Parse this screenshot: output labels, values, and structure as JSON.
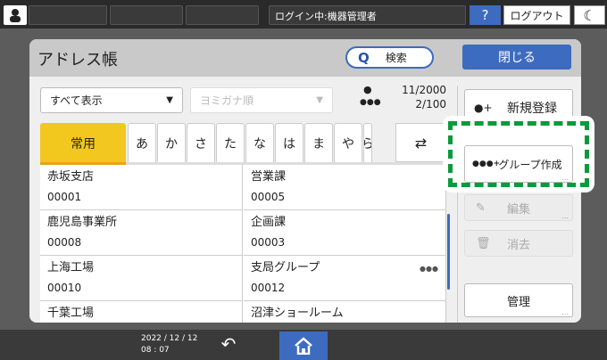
{
  "topbar": {
    "login_status": "ログイン中:機器管理者",
    "help_label": "?",
    "logout_label": "ログアウト"
  },
  "header": {
    "title": "アドレス帳",
    "search_label": "検索",
    "close_label": "閉じる"
  },
  "filters": {
    "display_select": "すべて表示",
    "sort_select": "ヨミガナ順"
  },
  "counts": {
    "users": "11/2000",
    "groups": "2/100"
  },
  "tabs": [
    "常用",
    "あ",
    "か",
    "さ",
    "た",
    "な",
    "は",
    "ま",
    "や",
    "ら"
  ],
  "entries": [
    {
      "name": "赤坂支店",
      "id": "00001",
      "group": false
    },
    {
      "name": "営業課",
      "id": "00005",
      "group": false
    },
    {
      "name": "鹿児島事業所",
      "id": "00008",
      "group": false
    },
    {
      "name": "企画課",
      "id": "00003",
      "group": false
    },
    {
      "name": "上海工場",
      "id": "00010",
      "group": false
    },
    {
      "name": "支局グループ",
      "id": "00012",
      "group": true
    },
    {
      "name": "千葉工場",
      "id": "",
      "group": false
    },
    {
      "name": "沼津ショールーム",
      "id": "",
      "group": false
    }
  ],
  "actions": {
    "new_label": "新規登録",
    "group_label": "グループ作成",
    "edit_label": "編集",
    "delete_label": "消去",
    "manage_label": "管理"
  },
  "bottombar": {
    "date": "2022 / 12 / 12",
    "time": "08 : 07"
  },
  "colors": {
    "accent": "#3d6bbf",
    "tab_active": "#f2c81e",
    "highlight": "#0a9a3c"
  }
}
